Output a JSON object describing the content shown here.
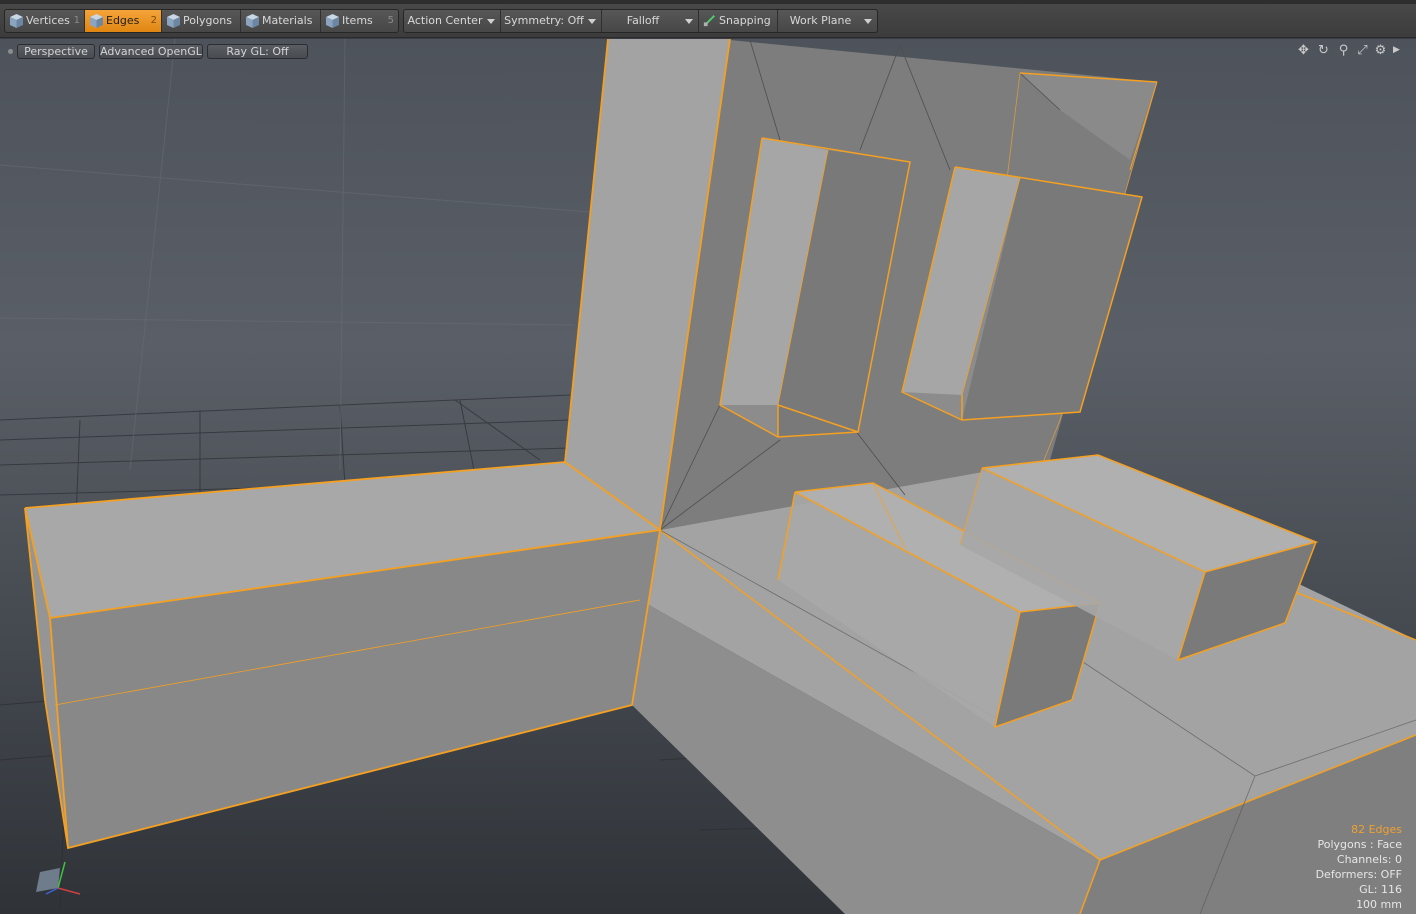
{
  "toolbar": {
    "modes": [
      {
        "label": "Vertices",
        "key": "1"
      },
      {
        "label": "Edges",
        "key": "2"
      },
      {
        "label": "Polygons",
        "key": ""
      },
      {
        "label": "Materials",
        "key": ""
      },
      {
        "label": "Items",
        "key": "5"
      }
    ],
    "active_mode": "Edges",
    "action_center": "Action Center",
    "symmetry": "Symmetry: Off",
    "falloff": "Falloff",
    "snapping": "Snapping",
    "work_plane": "Work Plane"
  },
  "viewport": {
    "view": "Perspective",
    "shading": "Advanced OpenGL",
    "raygl": "Ray GL: Off"
  },
  "stats": {
    "selection": "82 Edges",
    "polygons": "Polygons : Face",
    "channels": "Channels: 0",
    "deformers": "Deformers: OFF",
    "gl": "GL: 116",
    "unit": "100 mm"
  },
  "colors": {
    "accent": "#f0a030",
    "selected_edge": "#f5a020",
    "mesh_face": "#9a9a9a"
  }
}
